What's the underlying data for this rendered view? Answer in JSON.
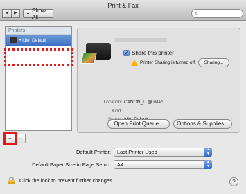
{
  "window": {
    "title": "Print & Fax"
  },
  "toolbar": {
    "back_glyph": "◀",
    "forward_glyph": "▶",
    "show_all_label": "Show All",
    "search_placeholder": "",
    "search_glyph": "⌕"
  },
  "printers_list": {
    "header": "Printers",
    "selected": {
      "status": "• Idle, Default"
    }
  },
  "list_controls": {
    "add_label": "+",
    "remove_label": "−"
  },
  "detail": {
    "share_checkbox": {
      "label": "Share this printer",
      "checked": true,
      "check_glyph": "✓"
    },
    "warning": {
      "text": "Printer Sharing is turned off.",
      "button_label": "Sharing..."
    },
    "location": {
      "key": "Location:",
      "value": "CANON_IJ @ iMac"
    },
    "kind": {
      "key": "Kind:",
      "value": ""
    },
    "status": {
      "key": "Status:",
      "value": "Idle, Default"
    },
    "open_queue_label": "Open Print Queue...",
    "options_label": "Options & Supplies..."
  },
  "defaults": {
    "printer": {
      "label": "Default Printer:",
      "value": "Last Printer Used"
    },
    "paper": {
      "label": "Default Paper Size in Page Setup:",
      "value": "A4"
    }
  },
  "footer": {
    "lock_text": "Click the lock to prevent further changes.",
    "help_label": "?"
  },
  "icons": {
    "back": "back-arrow-icon",
    "forward": "forward-arrow-icon",
    "show_all": "grid-icon",
    "search": "search-icon",
    "printer": "printer-icon",
    "warning": "warning-icon",
    "lock": "lock-icon",
    "help": "help-icon"
  },
  "colors": {
    "selection": "#3a6ec4",
    "annotation": "#e01a1a",
    "warning": "#f2b705"
  }
}
